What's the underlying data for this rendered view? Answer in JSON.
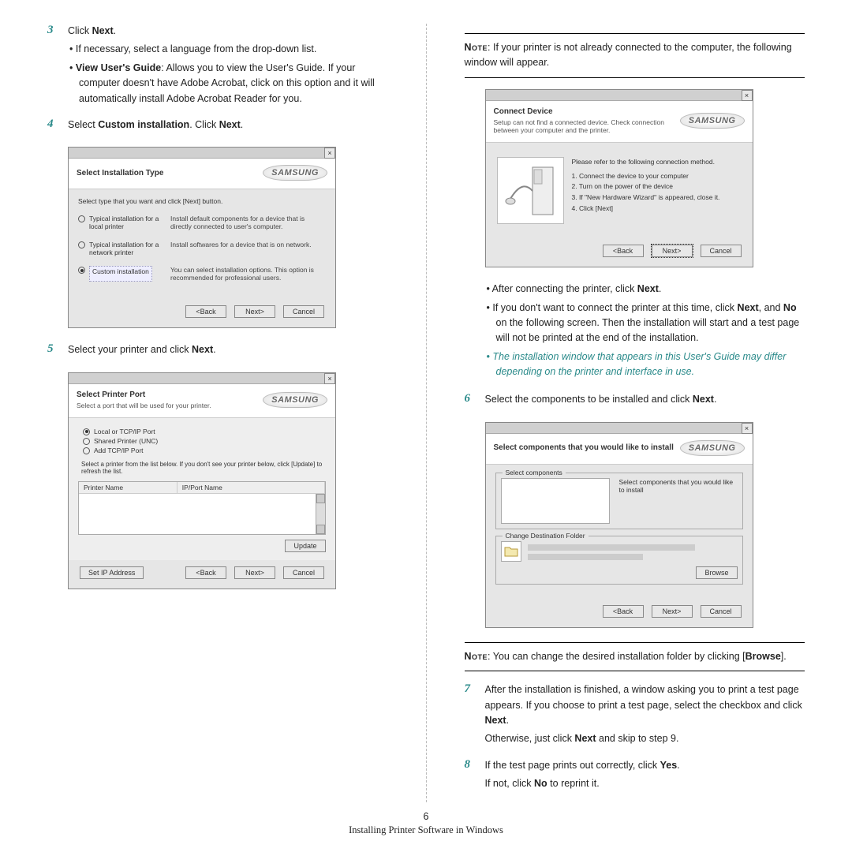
{
  "brand": "SAMSUNG",
  "col1": {
    "step3": {
      "num": "3",
      "line": "Click ",
      "bold": "Next",
      "tail": ".",
      "sub1": "If necessary, select a language from the drop-down list.",
      "sub2_lead": "View User's Guide",
      "sub2_rest": ": Allows you to view the User's Guide. If your computer doesn't have Adobe Acrobat, click on this option and it will automatically install Adobe Acrobat Reader for you."
    },
    "step4": {
      "num": "4",
      "a": "Select ",
      "b": "Custom installation",
      "c": ". Click ",
      "d": "Next",
      "e": "."
    },
    "dlg1": {
      "title": "Select Installation Type",
      "lead": "Select type that you want and click [Next] button.",
      "opt1": "Typical installation for a local printer",
      "opt1_desc": "Install default components for a device that is directly connected to user's computer.",
      "opt2": "Typical installation for a network printer",
      "opt2_desc": "Install softwares for a device that is on network.",
      "opt3": "Custom installation",
      "opt3_desc": "You can select installation options. This option is recommended for professional users.",
      "back": "<Back",
      "next": "Next>",
      "cancel": "Cancel"
    },
    "step5": {
      "num": "5",
      "a": "Select your printer and click ",
      "b": "Next",
      "c": "."
    },
    "dlg2": {
      "title": "Select Printer Port",
      "sub": "Select a port that will be used for your printer.",
      "r1": "Local or TCP/IP Port",
      "r2": "Shared Printer (UNC)",
      "r3": "Add TCP/IP Port",
      "instr": "Select a printer from the list below. If you don't see your printer below, click [Update] to refresh the list.",
      "colA": "Printer Name",
      "colB": "IP/Port Name",
      "update": "Update",
      "setip": "Set IP Address",
      "back": "<Back",
      "next": "Next>",
      "cancel": "Cancel"
    }
  },
  "col2": {
    "note1a": "Note",
    "note1b": ": If your printer is not already connected to the computer, the following window will appear.",
    "dlg3": {
      "title": "Connect Device",
      "sub": "Setup can not find a connected device. Check connection between your computer and the printer.",
      "lead": "Please refer to the following connection method.",
      "s1": "1. Connect the device to your computer",
      "s2": "2. Turn on the power of the device",
      "s3": "3. If \"New Hardware Wizard\" is appeared, close it.",
      "s4": "4. Click [Next]",
      "back": "<Back",
      "next": "Next>",
      "cancel": "Cancel"
    },
    "bullets": {
      "b1a": "After connecting the printer, click ",
      "b1b": "Next",
      "b1c": ".",
      "b2a": "If you don't want to connect the printer at this time, click ",
      "b2b": "Next",
      "b2c": ", and ",
      "b2d": "No",
      "b2e": " on the following screen. Then the installation will start and a test page will not be printed at the end of the installation.",
      "b3": "The installation window that appears in this User's Guide may differ depending on the printer and interface in use."
    },
    "step6": {
      "num": "6",
      "a": "Select the components to be installed and click ",
      "b": "Next",
      "c": "."
    },
    "dlg4": {
      "title": "Select components that you would like to install",
      "grp": "Select components",
      "side": "Select components that you would like to install",
      "dest": "Change Destination Folder",
      "browse": "Browse",
      "back": "<Back",
      "next": "Next>",
      "cancel": "Cancel"
    },
    "note2a": "Note",
    "note2b": ": You can change the desired installation folder by clicking [",
    "note2c": "Browse",
    "note2d": "].",
    "step7": {
      "num": "7",
      "a": "After the installation is finished, a window asking you to print a test page appears. If you choose to print a test page, select the checkbox and click ",
      "b": "Next",
      "c": ".",
      "d": "Otherwise, just click ",
      "e": "Next",
      "f": " and skip to step 9."
    },
    "step8": {
      "num": "8",
      "a": "If the test page prints out correctly, click ",
      "b": "Yes",
      "c": ".",
      "d": "If not, click ",
      "e": "No",
      "f": " to reprint it."
    }
  },
  "footer": {
    "page": "6",
    "title": "Installing Printer Software in Windows"
  }
}
